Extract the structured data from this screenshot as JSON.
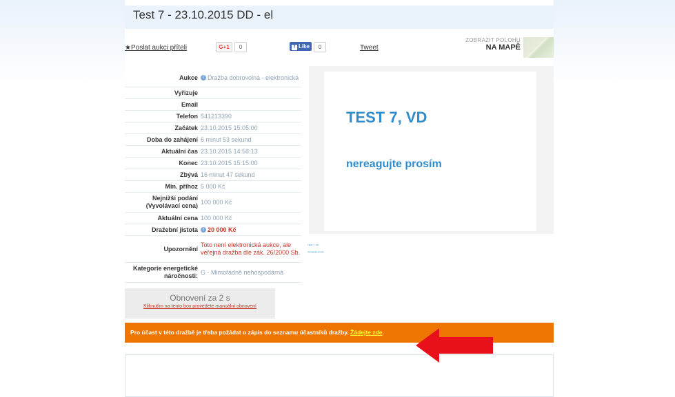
{
  "title": "Test 7 - 23.10.2015 DD - el",
  "share": {
    "send_link": "Poslat aukci příteli",
    "gplus_label": "G+1",
    "gplus_count": "0",
    "fb_label": "Like",
    "fb_count": "0",
    "tweet": "Tweet"
  },
  "map": {
    "line1": "ZOBRAZIT POLOHU",
    "line2": "NA MAPĚ"
  },
  "info_rows": [
    {
      "label": "Aukce",
      "value": "Dražba dobrovolná - elektronická"
    },
    {
      "label": "Vyřizuje",
      "value": ""
    },
    {
      "label": "Email",
      "value": ""
    },
    {
      "label": "Telefon",
      "value": "541213390"
    },
    {
      "label": "Začátek",
      "value": "23.10.2015 15:05:00"
    },
    {
      "label": "Doba do zahájení",
      "value": "6 minut 53 sekund"
    },
    {
      "label": "Aktuální čas",
      "value": "23.10.2015 14:58:13"
    },
    {
      "label": "Konec",
      "value": "23.10.2015 15:15:00"
    },
    {
      "label": "Zbývá",
      "value": "16 minut 47 sekund"
    },
    {
      "label": "Min. příhoz",
      "value": "5 000 Kč"
    },
    {
      "label": "Nejnižší podání (Vyvolávací cena)",
      "value": "100 000 Kč"
    },
    {
      "label": "Aktuální cena",
      "value": "100 000 Kč"
    },
    {
      "label": "Dražební jistota",
      "value": "20 000 Kč"
    },
    {
      "label": "Upozornění",
      "value": "Toto není elektronická aukce, ale veřejná dražba dle zák. 26/2000 Sb."
    },
    {
      "label": "Kategorie energetické náročnosti:",
      "value": "G - Mimořádně nehospodárná"
    }
  ],
  "refresh": {
    "title": "Obnovení za 2 s",
    "link": "Kliknutím na tento box provedete manuální obnovení"
  },
  "preview": {
    "line1": "TEST 7, VD",
    "line2": "nereagujte prosím"
  },
  "banner": {
    "text": "Pro účast v této dražbě je třeba požádat o zápis do seznamu účastníků dražby.",
    "link": "Žádejte zde",
    "dot": "."
  },
  "colors": {
    "banner": "#ee7600",
    "arrow": "#e8111b",
    "accent": "#2f8ccd"
  }
}
